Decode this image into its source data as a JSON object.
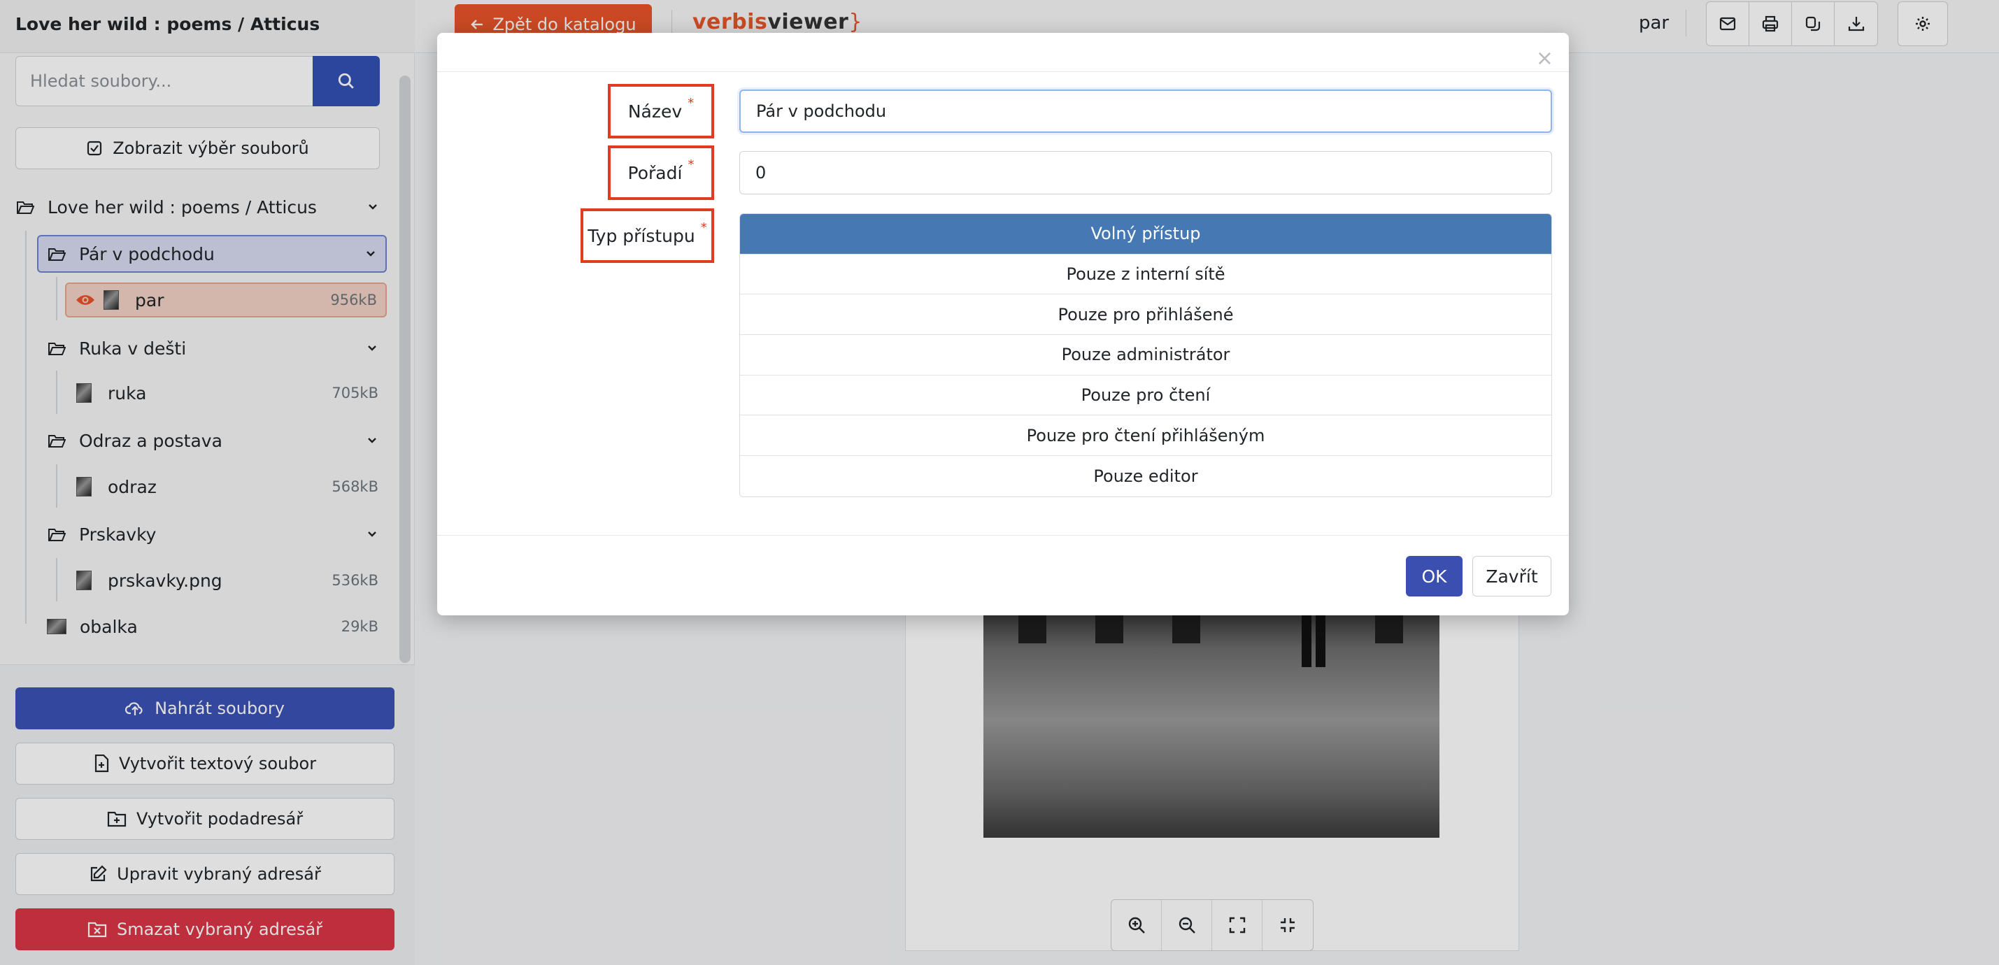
{
  "sidebar": {
    "title": "Love her wild : poems / Atticus",
    "search_placeholder": "Hledat soubory...",
    "show_selection_label": "Zobrazit výběr souborů",
    "tree": {
      "root": {
        "label": "Love her wild : poems / Atticus"
      },
      "folders": [
        {
          "label": "Pár v podchodu",
          "selected": true,
          "file": {
            "name": "par",
            "size": "956kB",
            "active": true
          }
        },
        {
          "label": "Ruka v dešti",
          "file": {
            "name": "ruka",
            "size": "705kB"
          }
        },
        {
          "label": "Odraz a postava",
          "file": {
            "name": "odraz",
            "size": "568kB"
          }
        },
        {
          "label": "Prskavky",
          "file": {
            "name": "prskavky.png",
            "size": "536kB"
          }
        }
      ],
      "cover": {
        "name": "obalka",
        "size": "29kB"
      }
    },
    "actions": {
      "upload": "Nahrát soubory",
      "create_text": "Vytvořit textový soubor",
      "create_subdir": "Vytvořit podadresář",
      "edit_dir": "Upravit vybraný adresář",
      "delete_dir": "Smazat vybraný adresář"
    }
  },
  "topbar": {
    "back_label": "Zpět do katalogu",
    "brand": {
      "part1": "verbis",
      "part2": "viewer",
      "part3": "}"
    },
    "current_file": "par",
    "icons": [
      "mail-icon",
      "print-icon",
      "copy-icon",
      "download-icon",
      "settings-icon"
    ]
  },
  "modal": {
    "close_symbol": "×",
    "name_label": "Název",
    "name_value": "Pár v podchodu",
    "order_label": "Pořadí",
    "order_value": "0",
    "access_label": "Typ přístupu",
    "required_mark": "*",
    "access_options": [
      {
        "label": "Volný přístup",
        "active": true
      },
      {
        "label": "Pouze z interní sítě"
      },
      {
        "label": "Pouze pro přihlášené"
      },
      {
        "label": "Pouze administrátor"
      },
      {
        "label": "Pouze pro čtení"
      },
      {
        "label": "Pouze pro čtení přihlášeným"
      },
      {
        "label": "Pouze editor"
      }
    ],
    "ok_label": "OK",
    "close_label": "Zavřít"
  },
  "colors": {
    "accent_orange": "#e8542a",
    "primary_blue": "#3a52b5",
    "active_access": "#4678b4",
    "danger": "#dc3545",
    "highlight_box": "#e03c1e"
  }
}
